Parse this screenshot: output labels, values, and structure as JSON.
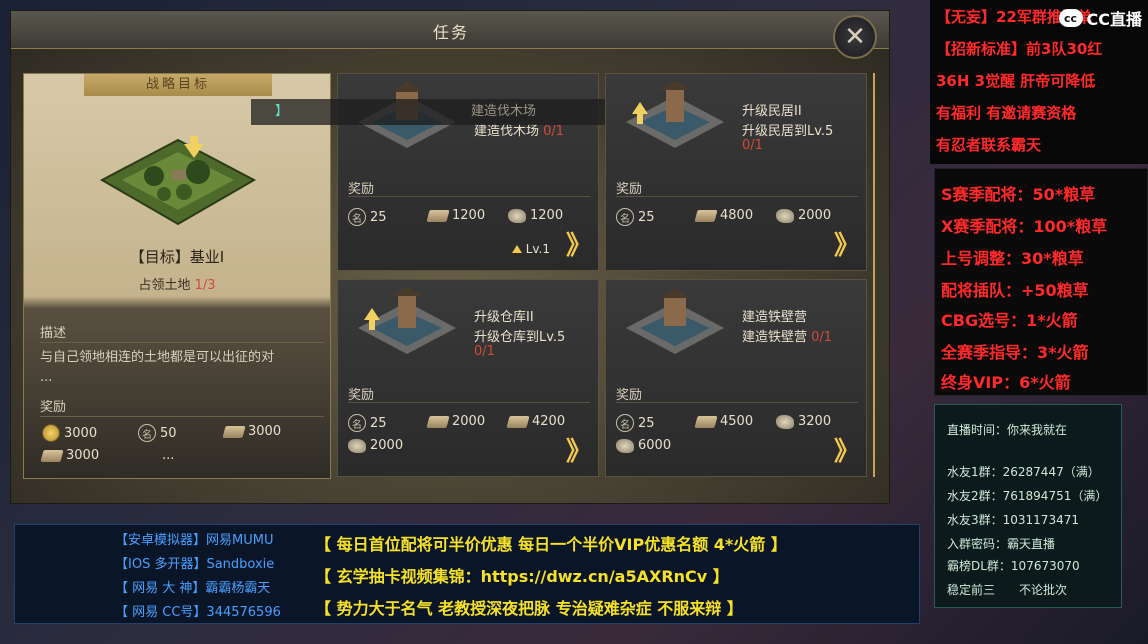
{
  "game": {
    "title": "任务",
    "close_label": "✕",
    "objective": {
      "header": "战略目标",
      "name": "【目标】基业I",
      "progress_label": "占领土地",
      "progress_value": "1/3",
      "desc_label": "描述",
      "desc": "与自己领地相连的土地都是可以出征的对",
      "desc_more": "...",
      "reward_label": "奖励",
      "rewards": [
        {
          "icon": "coin-icon",
          "value": "3000"
        },
        {
          "icon": "fame-icon",
          "value": "50"
        },
        {
          "icon": "wood-icon",
          "value": "3000"
        },
        {
          "icon": "iron-icon",
          "value": "3000"
        },
        {
          "icon": "more-icon",
          "value": "..."
        }
      ]
    },
    "tooltip": {
      "bracket": "】",
      "text": "建造伐木场"
    },
    "cards": [
      {
        "title": "",
        "sub": "建造伐木场",
        "progress": "0/1",
        "reward_label": "奖励",
        "rewards": [
          "25",
          "1200",
          "1200"
        ],
        "level": "Lv.1",
        "go": "》"
      },
      {
        "title": "升级民居II",
        "sub": "升级民居到Lv.5",
        "progress": "0/1",
        "reward_label": "奖励",
        "rewards": [
          "25",
          "4800",
          "2000"
        ],
        "go": "》"
      },
      {
        "title": "升级仓库II",
        "sub": "升级仓库到Lv.5",
        "progress": "0/1",
        "reward_label": "奖励",
        "rewards": [
          "25",
          "2000",
          "4200",
          "2000"
        ],
        "go": "》"
      },
      {
        "title": "建造铁壁营",
        "sub": "建造铁壁营",
        "progress": "0/1",
        "reward_label": "奖励",
        "rewards": [
          "25",
          "4500",
          "3200",
          "6000"
        ],
        "go": "》"
      }
    ]
  },
  "promo_top": {
    "lines": [
      "【无妄】22军群推迟单",
      "【招新标准】前3队30红",
      "36H 3觉醒 肝帝可降低",
      "有福利 有邀请赛资格",
      "有忍者联系霸天"
    ],
    "logo": "CC直播",
    "logo_mark": "cc"
  },
  "price_list": [
    "S赛季配将：50*粮草",
    "X赛季配将：100*粮草",
    "上号调整：30*粮草",
    "配将插队：+50粮草",
    "CBG选号：1*火箭",
    "全赛季指导：3*火箭",
    "终身VIP：6*火箭"
  ],
  "info": [
    "直播时间：你来我就在",
    "",
    "水友1群：26287447（满）",
    "水友2群：761894751（满）",
    "水友3群：1031173471",
    "入群密码：霸天直播",
    "霸榜DL群：107673070",
    "稳定前三　　不论批次"
  ],
  "bottom_left": [
    {
      "label": "【安卓模拟器】",
      "value": "网易MUMU"
    },
    {
      "label": "【IOS 多开器】",
      "value": "Sandboxie"
    },
    {
      "label": "【 网易 大 神】",
      "value": "霸霸杨霸天"
    },
    {
      "label": "【 网易  CC号】",
      "value": "344576596"
    }
  ],
  "bottom_center": [
    "【  每日首位配将可半价优惠  每日一个半价VIP优惠名额 4*火箭  】",
    "【         玄学抽卡视频集锦：https://dwz.cn/a5AXRnCv        】",
    "【  势力大于名气  老教授深夜把脉   专治疑难杂症   不服来辩   】"
  ],
  "colors": {
    "accent_gold": "#f0c850",
    "promo_red": "#ff2a2a",
    "banner_yellow": "#f5e12a",
    "banner_blue": "#4aa0ff"
  }
}
